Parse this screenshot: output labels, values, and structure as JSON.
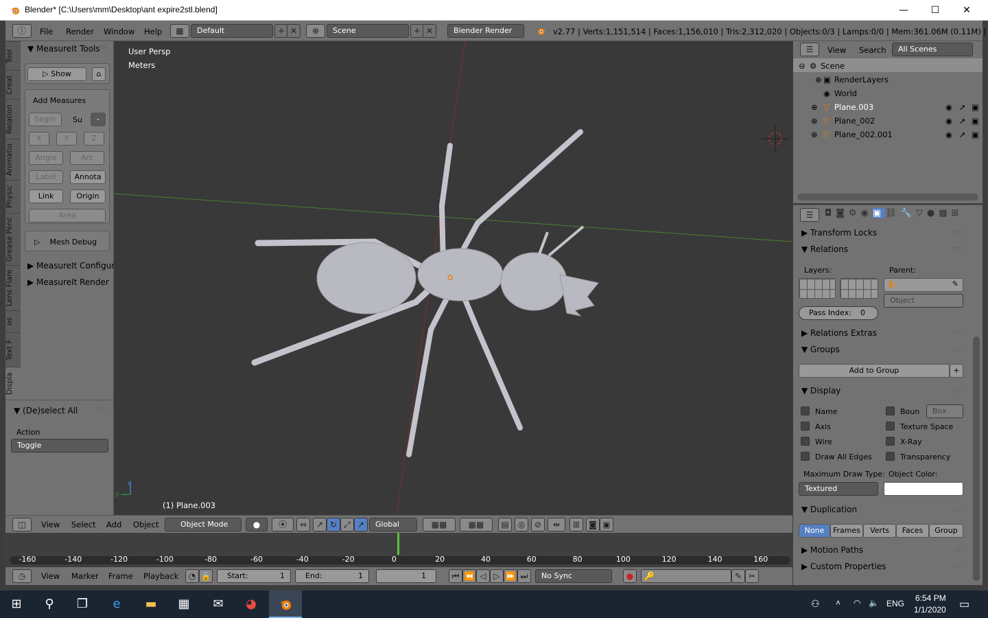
{
  "window": {
    "title": "Blender* [C:\\Users\\mm\\Desktop\\ant expire2stl.blend]",
    "minimize": "—",
    "maximize": "☐",
    "close": "✕"
  },
  "infobar": {
    "menus": [
      "File",
      "Render",
      "Window",
      "Help"
    ],
    "layout": "Default",
    "scene": "Scene",
    "engine": "Blender Render",
    "stats": "v2.77 | Verts:1,151,514 | Faces:1,156,010 | Tris:2,312,020 | Objects:0/3 | Lamps:0/0 | Mem:361.06M (0.11M) | Plane.003"
  },
  "toolshelf": {
    "tabs": [
      "Tool",
      "Creat",
      "Relation",
      "Animatio",
      "Physic",
      "Grease Penc",
      "Lens Flare",
      "os",
      "Text F",
      "Displa"
    ],
    "panel_title": "MeasureIt Tools",
    "show_button": "Show",
    "add_measures": "Add Measures",
    "segm": "Segm",
    "su": "Su",
    "dropdown_val": "-",
    "x": "X",
    "y": "Y",
    "z": "Z",
    "angle": "Angle",
    "arc": "Arc",
    "label": "Label",
    "annota": "Annota",
    "link": "Link",
    "origin": "Origin",
    "area": "Area",
    "mesh_debug": "Mesh Debug",
    "configura": "MeasureIt Configura",
    "render": "MeasureIt Render"
  },
  "redo": {
    "title": "(De)select All",
    "action_label": "Action",
    "action_value": "Toggle"
  },
  "viewport": {
    "persp": "User Persp",
    "units": "Meters",
    "object": "(1) Plane.003"
  },
  "v3dheader": {
    "menus": [
      "View",
      "Select",
      "Add",
      "Object"
    ],
    "mode": "Object Mode",
    "orientation": "Global"
  },
  "timeline": {
    "ticks": [
      "-160",
      "-140",
      "-120",
      "-100",
      "-80",
      "-60",
      "-40",
      "-20",
      "0",
      "20",
      "40",
      "60",
      "80",
      "100",
      "120",
      "140",
      "160"
    ],
    "menus": [
      "View",
      "Marker",
      "Frame",
      "Playback"
    ],
    "start_label": "Start:",
    "start_val": "1",
    "end_label": "End:",
    "end_val": "1",
    "current": "1",
    "sync": "No Sync"
  },
  "outliner": {
    "view": "View",
    "search": "Search",
    "filter": "All Scenes",
    "items": [
      "Scene",
      "RenderLayers",
      "World",
      "Plane.003",
      "Plane_002",
      "Plane_002.001"
    ]
  },
  "properties": {
    "transform_locks": "Transform Locks",
    "relations": "Relations",
    "layers": "Layers:",
    "parent": "Parent:",
    "parent_type": "Object",
    "pass_index_label": "Pass Index:",
    "pass_index": "0",
    "relations_extras": "Relations Extras",
    "groups": "Groups",
    "add_to_group": "Add to Group",
    "display": "Display",
    "name": "Name",
    "axis": "Axis",
    "wire": "Wire",
    "draw_all_edges": "Draw All Edges",
    "boun": "Boun",
    "box": "Box",
    "texture_space": "Texture Space",
    "xray": "X-Ray",
    "transparency": "Transparency",
    "max_draw_type": "Maximum Draw Type:",
    "object_color": "Object Color:",
    "textured": "Textured",
    "duplication": "Duplication",
    "dup_options": [
      "None",
      "Frames",
      "Verts",
      "Faces",
      "Group"
    ],
    "motion_paths": "Motion Paths",
    "custom_properties": "Custom Properties"
  },
  "taskbar": {
    "lang": "ENG",
    "time": "6:54 PM",
    "date": "1/1/2020"
  },
  "colors": {
    "accent_blue": "#5680c2",
    "header_gray": "#727272",
    "viewport": "#393939"
  }
}
